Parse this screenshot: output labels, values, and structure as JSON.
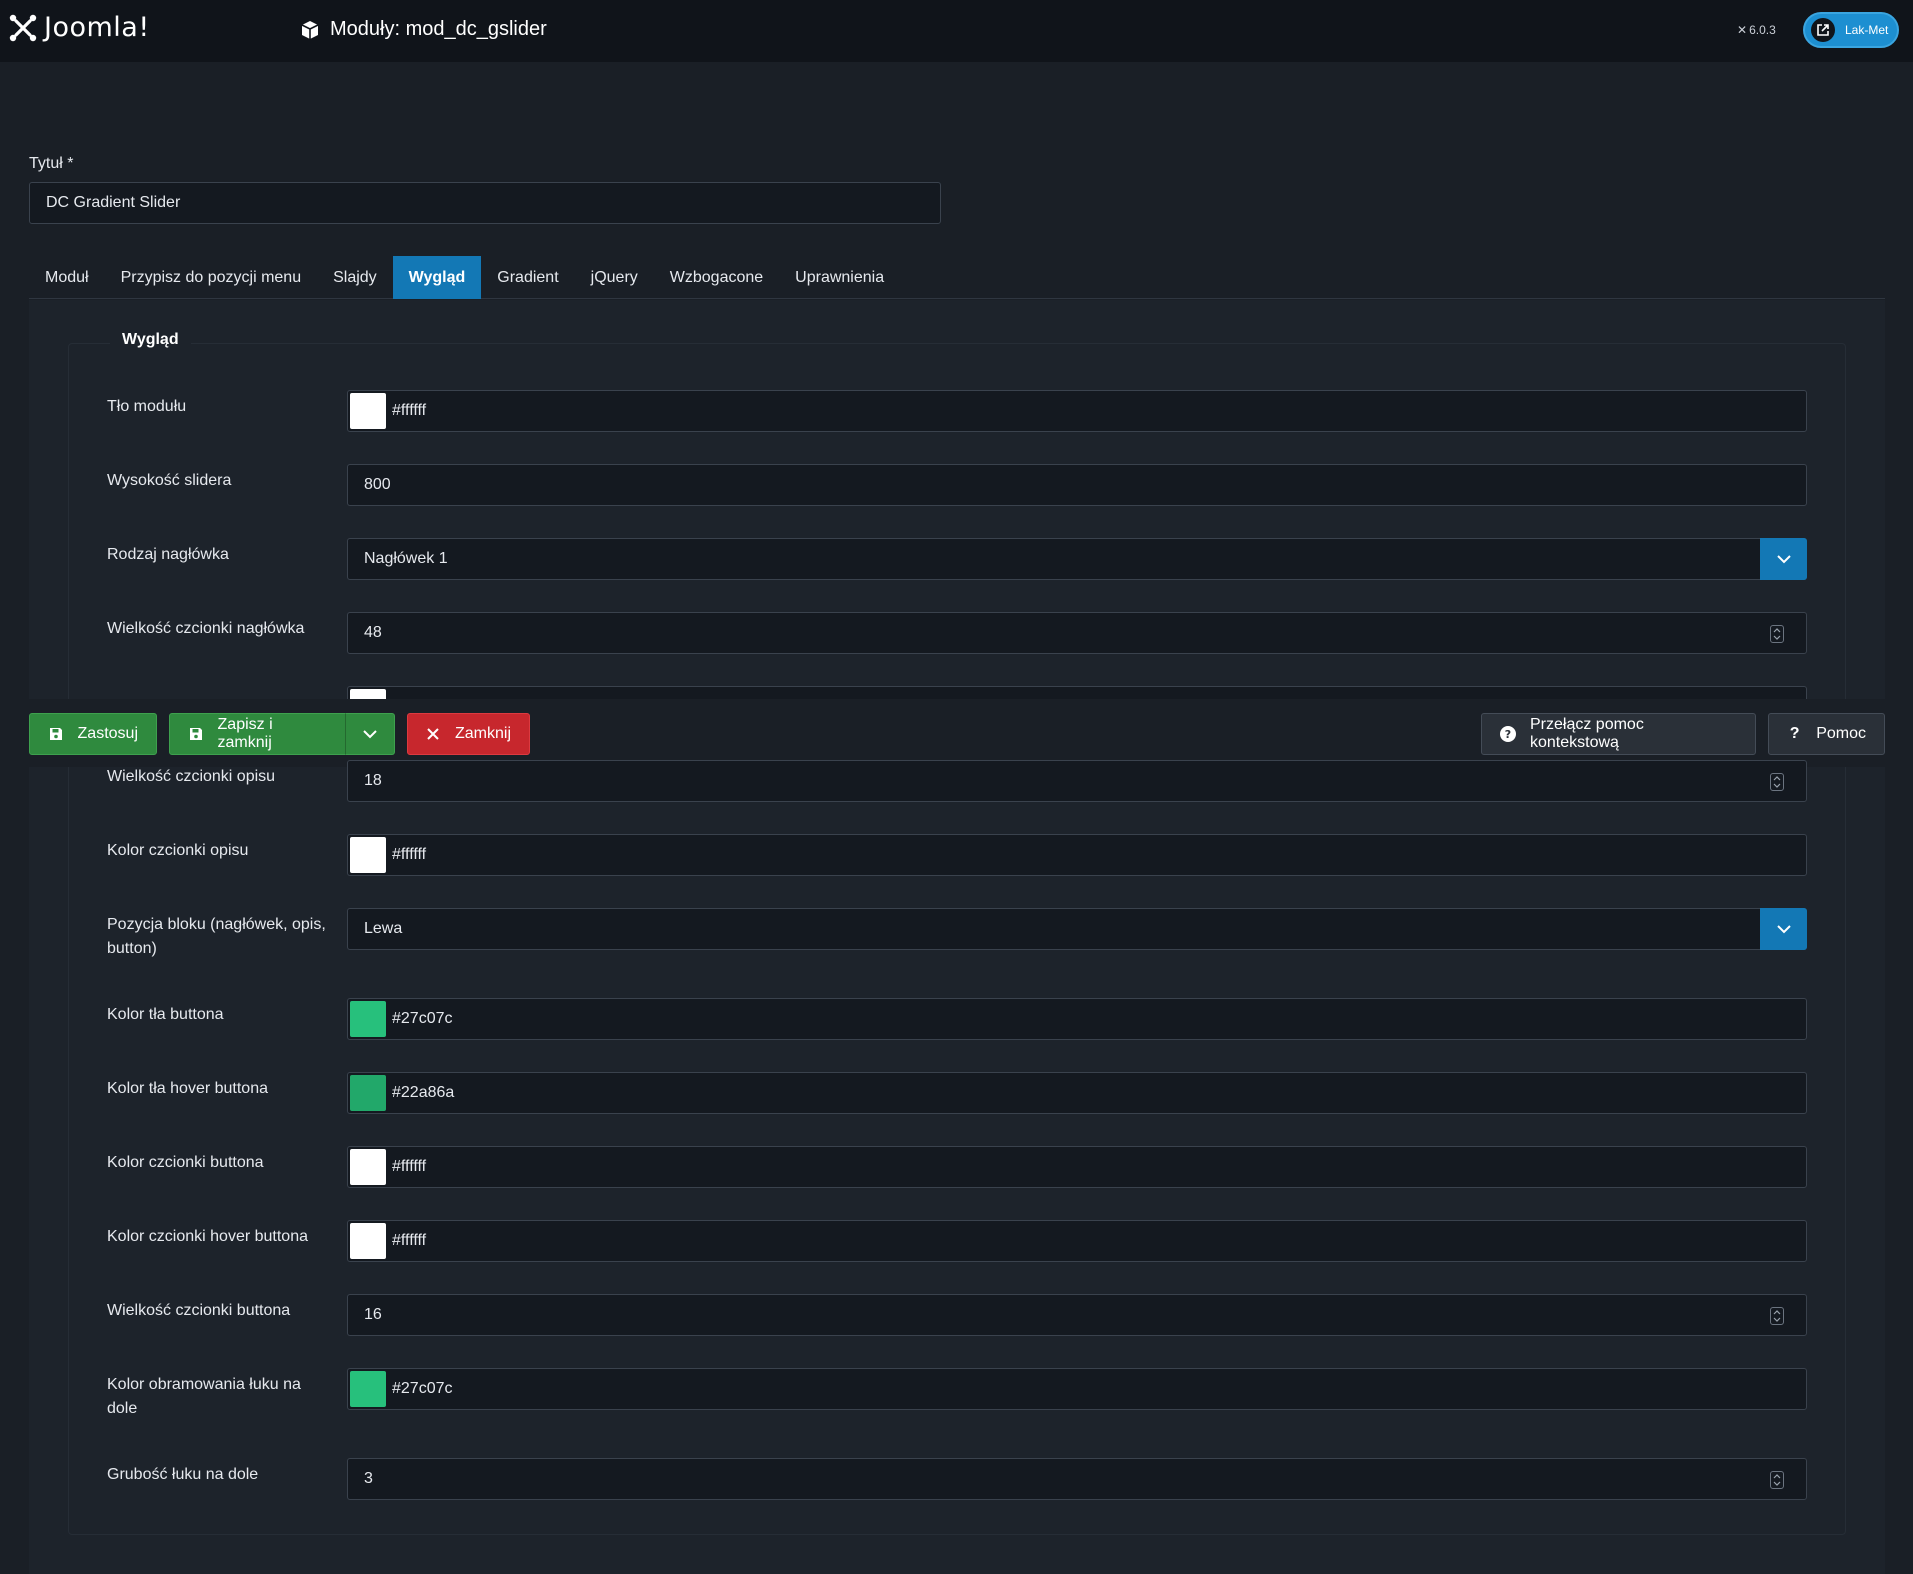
{
  "header": {
    "brand": "Joomla!",
    "page_title": "Moduły: mod_dc_gslider",
    "version": "6.0.3",
    "site_button": "Lak-Met"
  },
  "title_field": {
    "label": "Tytuł *",
    "value": "DC Gradient Slider"
  },
  "tabs": [
    {
      "label": "Moduł",
      "active": false
    },
    {
      "label": "Przypisz do pozycji menu",
      "active": false
    },
    {
      "label": "Slajdy",
      "active": false
    },
    {
      "label": "Wygląd",
      "active": true
    },
    {
      "label": "Gradient",
      "active": false
    },
    {
      "label": "jQuery",
      "active": false
    },
    {
      "label": "Wzbogacone",
      "active": false
    },
    {
      "label": "Uprawnienia",
      "active": false
    }
  ],
  "section": {
    "legend": "Wygląd",
    "fields": [
      {
        "label": "Tło modułu",
        "type": "color",
        "value": "#ffffff",
        "color": "#ffffff"
      },
      {
        "label": "Wysokość slidera",
        "type": "text",
        "value": "800"
      },
      {
        "label": "Rodzaj nagłówka",
        "type": "select",
        "value": "Nagłówek 1"
      },
      {
        "label": "Wielkość czcionki nagłówka",
        "type": "number",
        "value": "48"
      },
      {
        "label": "Wielkość czcionki opisu",
        "type": "number",
        "value": "18"
      },
      {
        "label": "Kolor czcionki opisu",
        "type": "color",
        "value": "#ffffff",
        "color": "#ffffff"
      },
      {
        "label": "Pozycja bloku (nagłówek, opis, button)",
        "type": "select",
        "value": "Lewa"
      },
      {
        "label": "Kolor tła buttona",
        "type": "color",
        "value": "#27c07c",
        "color": "#27c07c"
      },
      {
        "label": "Kolor tła hover buttona",
        "type": "color",
        "value": "#22a86a",
        "color": "#22a86a"
      },
      {
        "label": "Kolor czcionki buttona",
        "type": "color",
        "value": "#ffffff",
        "color": "#ffffff"
      },
      {
        "label": "Kolor czcionki hover buttona",
        "type": "color",
        "value": "#ffffff",
        "color": "#ffffff"
      },
      {
        "label": "Wielkość czcionki buttona",
        "type": "number",
        "value": "16"
      },
      {
        "label": "Kolor obramowania łuku na dole",
        "type": "color",
        "value": "#27c07c",
        "color": "#27c07c"
      },
      {
        "label": "Grubość łuku na dole",
        "type": "number",
        "value": "3"
      }
    ]
  },
  "toolbar": {
    "apply": "Zastosuj",
    "save_close": "Zapisz i zamknij",
    "close": "Zamknij",
    "contextual_help": "Przełącz pomoc kontekstową",
    "help": "Pomoc"
  },
  "colors": {
    "accent": "#1378b5",
    "success": "#2f8a3e",
    "danger": "#c7272d"
  }
}
